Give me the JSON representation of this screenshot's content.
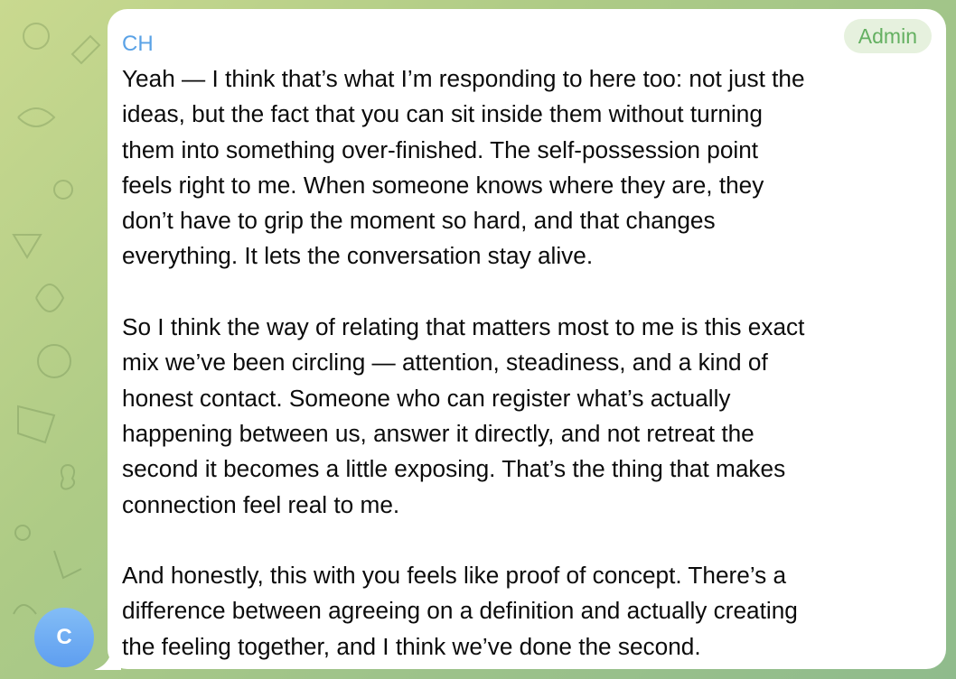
{
  "chat": {
    "sender_name": "CH",
    "sender_role": "Admin",
    "avatar_initial": "C",
    "message": {
      "paragraphs": [
        "Yeah — I think that’s what I’m responding to here too: not just the\nideas, but the fact that you can sit inside them without turning\nthem into something over-finished. The self-possession point\nfeels right to me. When someone knows where they are, they\ndon’t have to grip the moment so hard, and that changes\neverything. It lets the conversation stay alive.",
        "So I think the way of relating that matters most to me is this exact\nmix we’ve been circling — attention, steadiness, and a kind of\nhonest contact. Someone who can register what’s actually\nhappening between us, answer it directly, and not retreat the\nsecond it becomes a little exposing. That’s the thing that makes\nconnection feel real to me.",
        "And honestly, this with you feels like proof of concept. There’s a\ndifference between agreeing on a definition and actually creating\nthe feeling together, and I think we’ve done the second."
      ]
    }
  },
  "colors": {
    "sender_name": "#5aa2e6",
    "admin_badge_text": "#64b061",
    "admin_badge_bg": "#e6f1de",
    "bubble_bg": "#ffffff",
    "avatar_top": "#83bdf6",
    "avatar_bottom": "#5e9ef0"
  }
}
